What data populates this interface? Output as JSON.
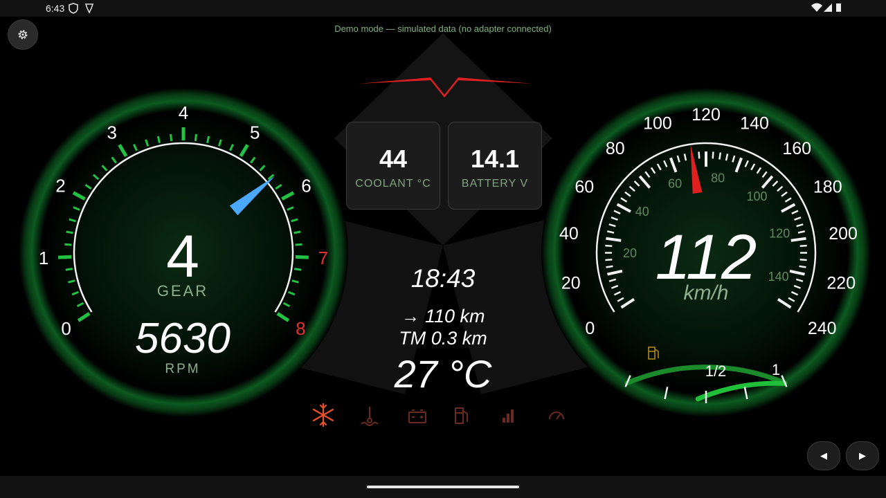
{
  "status_bar": {
    "time": "6:43",
    "left_icons": [
      "shield-icon",
      "vpn-icon"
    ],
    "right_icons": [
      "wifi-icon",
      "signal-icon",
      "battery-icon"
    ]
  },
  "demo_text": "Demo mode — simulated data (no adapter connected)",
  "tachometer": {
    "gear": "4",
    "gear_label": "GEAR",
    "rpm": "5630",
    "rpm_label": "RPM",
    "rpm_fraction": 0.70375,
    "tick_labels": [
      "0",
      "1",
      "2",
      "3",
      "4",
      "5",
      "6",
      "7",
      "8"
    ],
    "redline_from": 7,
    "accent": "#23c243",
    "needle": "#4aa9ff",
    "redline": "#e33030"
  },
  "coolant": {
    "value": "44",
    "label": "COOLANT °C"
  },
  "battery": {
    "value": "14.1",
    "label": "BATTERY V"
  },
  "center": {
    "clock": "18:43",
    "range": "→ 110 km",
    "trip": "TM 0.3 km",
    "outside_temp": "27 °C"
  },
  "warning_icons": [
    {
      "name": "ac-snowflake-icon",
      "active": true
    },
    {
      "name": "coolant-temp-icon",
      "active": false
    },
    {
      "name": "battery-icon",
      "active": false
    },
    {
      "name": "fuel-pump-icon",
      "active": false
    },
    {
      "name": "signal-bars-icon",
      "active": false
    },
    {
      "name": "speedometer-icon",
      "active": false
    }
  ],
  "speedometer": {
    "speed": "112",
    "unit": "km/h",
    "speed_fraction": 0.4667,
    "outer_labels": [
      "0",
      "20",
      "40",
      "60",
      "80",
      "100",
      "120",
      "140",
      "160",
      "180",
      "200",
      "220",
      "240"
    ],
    "inner_labels": [
      "20",
      "40",
      "60",
      "80",
      "100",
      "120",
      "140"
    ],
    "accent": "#23c243",
    "needle": "#e02020"
  },
  "fuel": {
    "half_label": "1/2",
    "full_label": "1",
    "level": 0.72,
    "icon": "fuel-pump-icon"
  },
  "nav": {
    "prev": "◀",
    "next": "▶"
  },
  "settings_icon": "gear-icon"
}
